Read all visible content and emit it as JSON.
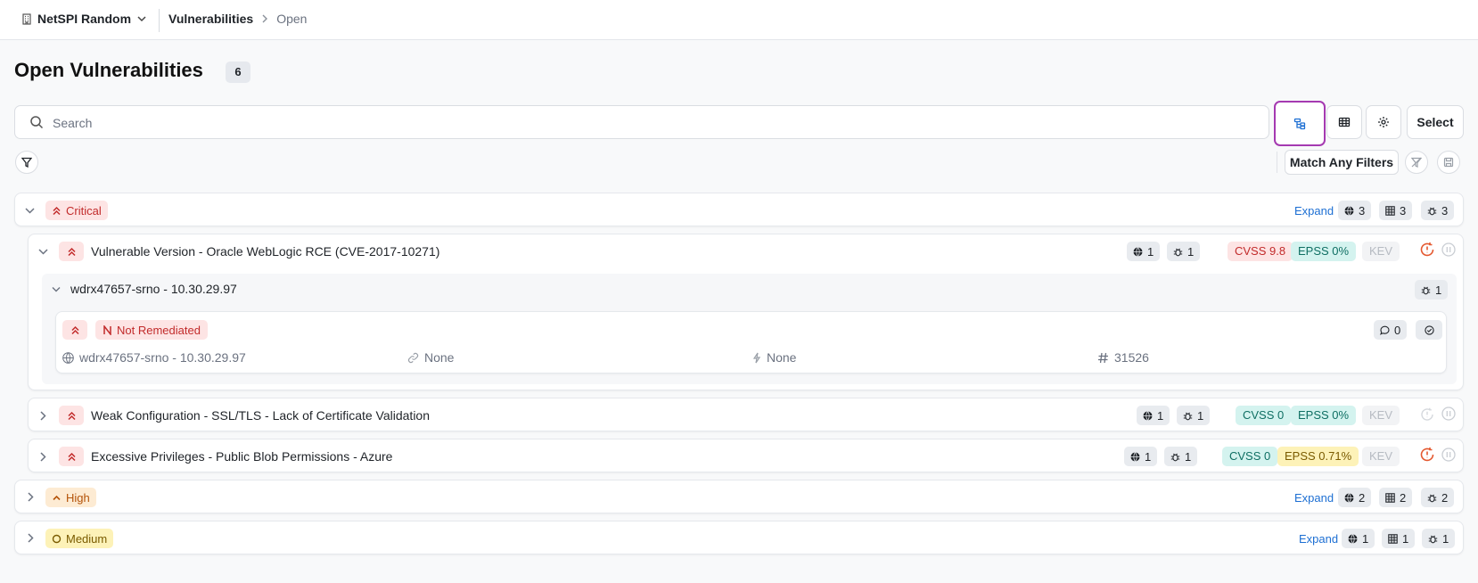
{
  "topbar": {
    "org_name": "NetSPI Random",
    "breadcrumb": {
      "current": "Vulnerabilities",
      "next": "Open"
    }
  },
  "page": {
    "title": "Open Vulnerabilities",
    "count": "6"
  },
  "search": {
    "placeholder": "Search",
    "value": ""
  },
  "toolbar": {
    "select_label": "Select",
    "match_filters_label": "Match Any Filters"
  },
  "groups": [
    {
      "severity": "Critical",
      "expand_label": "Expand",
      "stats": {
        "assets": "3",
        "instances": "3",
        "bugs": "3"
      },
      "vulnerabilities": [
        {
          "title": "Vulnerable Version - Oracle WebLogic RCE (CVE-2017-10271)",
          "assets": "1",
          "bugs": "1",
          "cvss": "CVSS 9.8",
          "epss": "EPSS 0%",
          "kev": "KEV",
          "host": {
            "name": "wdrx47657-srno - 10.30.29.97",
            "bugs": "1",
            "finding": {
              "status": "Not Remediated",
              "comments": "0",
              "asset": "wdrx47657-srno - 10.30.29.97",
              "link": "None",
              "source": "None",
              "id": "31526"
            }
          }
        },
        {
          "title": "Weak Configuration - SSL/TLS - Lack of Certificate Validation",
          "assets": "1",
          "bugs": "1",
          "cvss": "CVSS 0",
          "epss": "EPSS 0%",
          "kev": "KEV"
        },
        {
          "title": "Excessive Privileges - Public Blob Permissions - Azure",
          "assets": "1",
          "bugs": "1",
          "cvss": "CVSS 0",
          "epss": "EPSS 0.71%",
          "kev": "KEV"
        }
      ]
    },
    {
      "severity": "High",
      "expand_label": "Expand",
      "stats": {
        "assets": "2",
        "instances": "2",
        "bugs": "2"
      }
    },
    {
      "severity": "Medium",
      "expand_label": "Expand",
      "stats": {
        "assets": "1",
        "instances": "1",
        "bugs": "1"
      }
    }
  ],
  "colors": {
    "critical": "#c22b2b",
    "high": "#b45309",
    "medium": "#7a5b00",
    "accent": "#1d6fd3",
    "active_outline": "#a53ab1",
    "overdue": "#e4572e"
  },
  "icons": [
    "building-icon",
    "chevron-down-icon",
    "chevron-right-icon",
    "search-icon",
    "tree-view-icon",
    "table-view-icon",
    "gear-icon",
    "filter-icon",
    "clear-filter-icon",
    "save-filter-icon",
    "globe-icon",
    "table-icon",
    "bug-icon",
    "double-chevron-up-icon",
    "chevron-up-icon",
    "circle-icon",
    "comment-icon",
    "check-circle-icon",
    "link-icon",
    "bolt-icon",
    "hash-icon",
    "overdue-clock-icon",
    "pause-icon"
  ]
}
